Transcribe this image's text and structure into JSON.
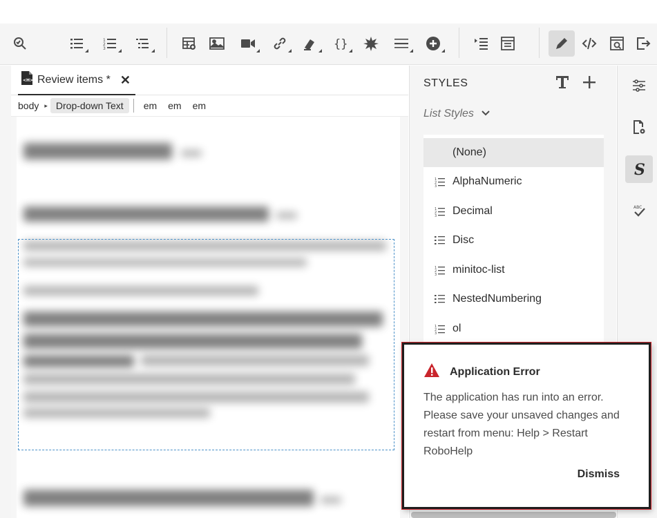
{
  "editor": {
    "tab": {
      "title": "Review items *",
      "close_glyph": "✕"
    },
    "breadcrumb": {
      "items": [
        "body",
        "Drop-down Text",
        "em",
        "em",
        "em"
      ],
      "separator": "▸"
    }
  },
  "styles_panel": {
    "title": "STYLES",
    "dropdown": "List Styles",
    "items": [
      {
        "label": "(None)",
        "icon": "none",
        "selected": true
      },
      {
        "label": "AlphaNumeric",
        "icon": "ordered-list-icon",
        "selected": false
      },
      {
        "label": "Decimal",
        "icon": "ordered-list-icon",
        "selected": false
      },
      {
        "label": "Disc",
        "icon": "bullet-list-icon",
        "selected": false
      },
      {
        "label": "minitoc-list",
        "icon": "ordered-list-icon",
        "selected": false
      },
      {
        "label": "NestedNumbering",
        "icon": "bullet-list-icon",
        "selected": false
      },
      {
        "label": "ol",
        "icon": "ordered-list-icon",
        "selected": false
      }
    ]
  },
  "dialog": {
    "title": "Application Error",
    "message": "The application has run into an error. Please save your unsaved changes and restart from menu: Help > Restart RoboHelp",
    "dismiss_label": "Dismiss",
    "accent_color": "#c9252c"
  },
  "toolbar": {
    "icons": [
      "find-replace-icon",
      "bullet-list-icon",
      "numbered-list-icon",
      "multilevel-list-icon",
      "insert-table-icon",
      "image-icon",
      "video-icon",
      "link-icon",
      "snippet-icon",
      "variable-icon",
      "special-char-icon",
      "horizontal-rule-icon",
      "add-icon",
      "insert-toc-icon",
      "mini-toc-icon",
      "author-icon",
      "source-icon",
      "preview-icon",
      "export-icon"
    ]
  }
}
